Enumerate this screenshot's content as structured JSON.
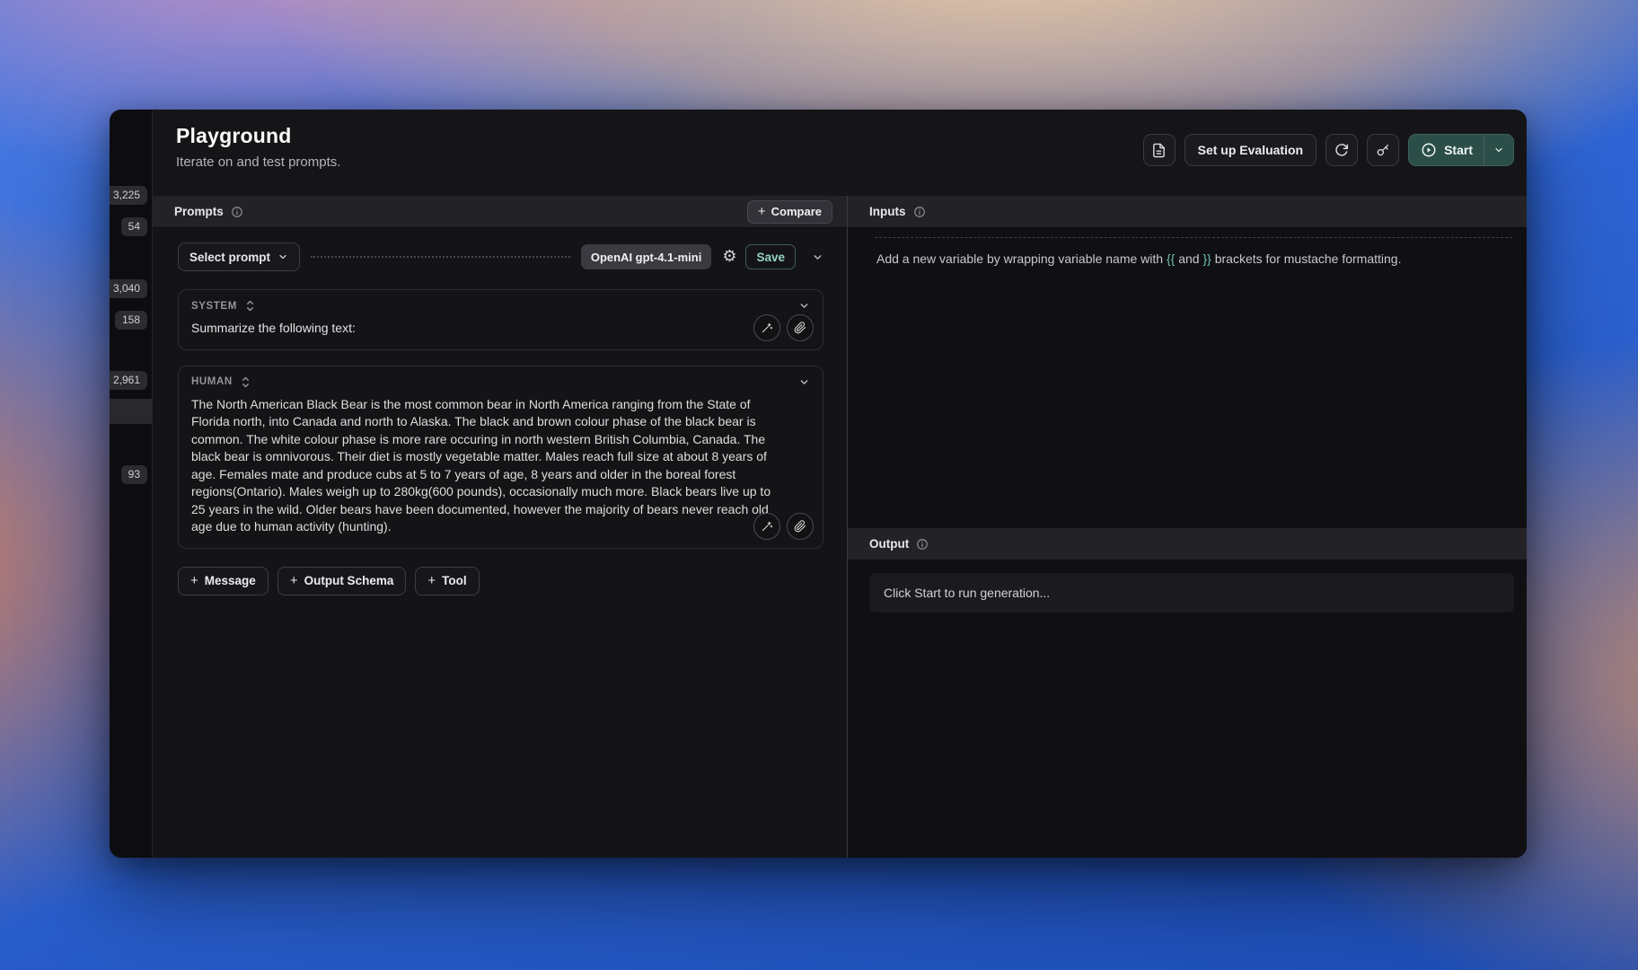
{
  "header": {
    "title": "Playground",
    "subtitle": "Iterate on and test prompts.",
    "setup_evaluation": "Set up Evaluation",
    "start": "Start"
  },
  "side_badges": {
    "b0": "3,225",
    "b1": "54",
    "b2": "3,040",
    "b3": "158",
    "b4": "2,961",
    "b5": "93"
  },
  "prompts": {
    "title": "Prompts",
    "plus": "+",
    "compare": "Compare",
    "select_prompt": "Select prompt",
    "model": "OpenAI gpt-4.1-mini",
    "gear_glyph": "⚙",
    "save": "Save",
    "messages": [
      {
        "role": "SYSTEM",
        "text": "Summarize the following text:"
      },
      {
        "role": "HUMAN",
        "text": "The North American Black Bear is the most common bear in North America ranging from the State of Florida north, into Canada and north to Alaska. The black and brown colour phase of the black bear is common. The white colour phase is more rare occuring in north western British Columbia, Canada. The black bear is omnivorous. Their diet is mostly vegetable matter. Males reach full size at about 8 years of age. Females mate and produce cubs at 5 to 7 years of age, 8 years and older in the boreal forest regions(Ontario). Males weigh up to 280kg(600 pounds), occasionally much more. Black bears live up to 25 years in the wild. Older bears have been documented, however the majority of bears never reach old age due to human activity (hunting)."
      }
    ],
    "add_message": "Message",
    "add_output_schema": "Output Schema",
    "add_tool": "Tool"
  },
  "inputs": {
    "title": "Inputs",
    "hint_part1": "Add a new variable by wrapping variable name with ",
    "hint_open": "{{",
    "hint_part2": " and ",
    "hint_close": "}}",
    "hint_part3": " brackets for mustache formatting."
  },
  "output": {
    "title": "Output",
    "placeholder": "Click Start to run generation..."
  },
  "colors": {
    "start_button_bg": "#2c4e49",
    "save_text": "#93d2c6",
    "brace_teal": "#6fbfb2",
    "window_bg": "#151518",
    "panel_header_bg": "#232327"
  }
}
